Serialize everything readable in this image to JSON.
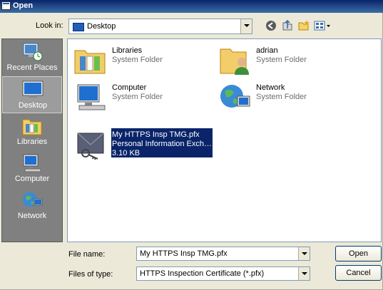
{
  "window": {
    "title": "Open"
  },
  "lookin": {
    "label": "Look in:",
    "value": "Desktop"
  },
  "places": [
    {
      "label": "Recent Places"
    },
    {
      "label": "Desktop",
      "active": true
    },
    {
      "label": "Libraries"
    },
    {
      "label": "Computer"
    },
    {
      "label": "Network"
    }
  ],
  "items": [
    {
      "name": "Libraries",
      "type": "System Folder",
      "icon": "libraries-icon"
    },
    {
      "name": "adrian",
      "type": "System Folder",
      "icon": "user-folder-icon"
    },
    {
      "name": "Computer",
      "type": "System Folder",
      "icon": "computer-icon"
    },
    {
      "name": "Network",
      "type": "System Folder",
      "icon": "network-icon"
    },
    {
      "name": "My HTTPS Insp TMG.pfx",
      "type": "Personal Information Exch…",
      "size": "3.10 KB",
      "icon": "certificate-icon",
      "selected": true
    }
  ],
  "filename": {
    "label": "File name:",
    "value": "My HTTPS Insp TMG.pfx"
  },
  "filetype": {
    "label": "Files of type:",
    "value": "HTTPS Inspection Certificate (*.pfx)"
  },
  "buttons": {
    "open": "Open",
    "cancel": "Cancel"
  }
}
